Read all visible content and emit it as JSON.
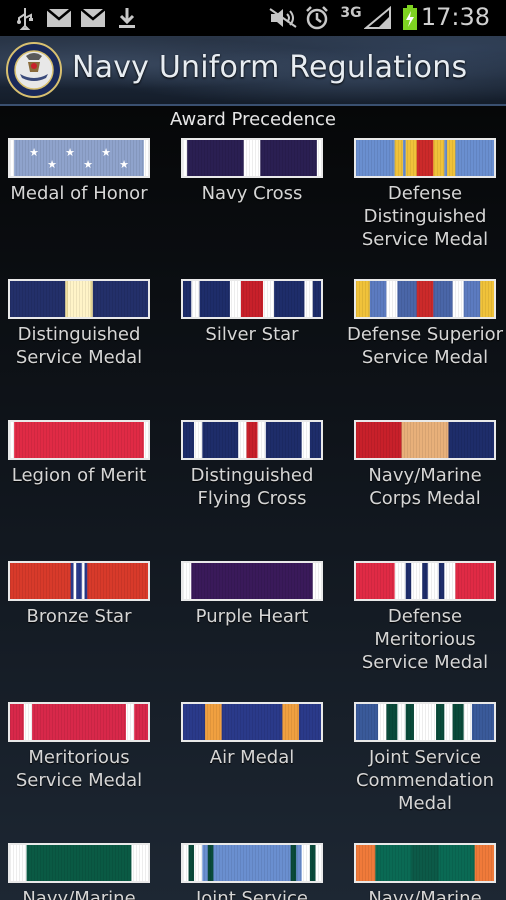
{
  "status_bar": {
    "icons": [
      "usb-icon",
      "gmail-icon",
      "gmail-icon",
      "download-icon",
      "mute-icon",
      "alarm-icon",
      "network-3g-icon",
      "signal-icon",
      "battery-charging-icon"
    ],
    "network_label": "3G",
    "time": "17:38"
  },
  "header": {
    "title": "Navy Uniform Regulations",
    "seal_icon": "navy-seal-icon"
  },
  "section_title": "Award Precedence",
  "awards": [
    {
      "name": "Medal of Honor",
      "slug": "medal-of-honor",
      "stripes": [
        [
          0,
          1,
          "#8fa3cc"
        ],
        [
          0,
          0.03,
          "#ffffff"
        ],
        [
          0.97,
          1,
          "#ffffff"
        ]
      ],
      "stars": true
    },
    {
      "name": "Navy Cross",
      "slug": "navy-cross",
      "stripes": [
        [
          0,
          1,
          "#2a1f52"
        ],
        [
          0.44,
          0.56,
          "#ffffff"
        ],
        [
          0,
          0.03,
          "#ffffff"
        ],
        [
          0.97,
          1,
          "#ffffff"
        ]
      ]
    },
    {
      "name": "Defense Distinguished Service Medal",
      "slug": "defense-distinguished-service-medal",
      "stripes": [
        [
          0,
          1,
          "#6a8fd0"
        ],
        [
          0.28,
          0.72,
          "#f0c23a"
        ],
        [
          0.44,
          0.56,
          "#cc2a2a"
        ],
        [
          0.34,
          0.36,
          "#6a8fd0"
        ],
        [
          0.64,
          0.66,
          "#6a8fd0"
        ]
      ]
    },
    {
      "name": "Distinguished Service Medal",
      "slug": "distinguished-service-medal",
      "stripes": [
        [
          0,
          1,
          "#23306a"
        ],
        [
          0.4,
          0.6,
          "#f0e0a0"
        ],
        [
          0.42,
          0.58,
          "#fff4c8"
        ]
      ]
    },
    {
      "name": "Silver Star",
      "slug": "silver-star",
      "stripes": [
        [
          0,
          1,
          "#1e2d6a"
        ],
        [
          0.06,
          0.12,
          "#ffffff"
        ],
        [
          0.88,
          0.94,
          "#ffffff"
        ],
        [
          0.34,
          0.66,
          "#ffffff"
        ],
        [
          0.42,
          0.58,
          "#c8202a"
        ]
      ]
    },
    {
      "name": "Defense Superior Service Medal",
      "slug": "defense-superior-service-medal",
      "stripes": [
        [
          0,
          1,
          "#f0c23a"
        ],
        [
          0.1,
          0.9,
          "#5c7bc0"
        ],
        [
          0.22,
          0.78,
          "#ffffff"
        ],
        [
          0.3,
          0.7,
          "#4a66a8"
        ],
        [
          0.44,
          0.56,
          "#cc2a2a"
        ]
      ]
    },
    {
      "name": "Legion of Merit",
      "slug": "legion-of-merit",
      "stripes": [
        [
          0,
          1,
          "#e02a45"
        ],
        [
          0,
          0.03,
          "#ffffff"
        ],
        [
          0.97,
          1,
          "#ffffff"
        ]
      ]
    },
    {
      "name": "Distinguished Flying Cross",
      "slug": "distinguished-flying-cross",
      "stripes": [
        [
          0,
          1,
          "#1e2d6a"
        ],
        [
          0.08,
          0.14,
          "#ffffff"
        ],
        [
          0.86,
          0.92,
          "#ffffff"
        ],
        [
          0.4,
          0.6,
          "#ffffff"
        ],
        [
          0.46,
          0.54,
          "#c8202a"
        ]
      ]
    },
    {
      "name": "Navy/Marine Corps Medal",
      "slug": "navy-marine-corps-medal",
      "stripes": [
        [
          0,
          1,
          "#1e2d6a"
        ],
        [
          0,
          0.33,
          "#c8202a"
        ],
        [
          0.33,
          0.67,
          "#e8b07a"
        ]
      ]
    },
    {
      "name": "Bronze Star",
      "slug": "bronze-star",
      "stripes": [
        [
          0,
          1,
          "#d83a2a"
        ],
        [
          0.44,
          0.56,
          "#2a3a8a"
        ],
        [
          0.46,
          0.54,
          "#ffffff"
        ],
        [
          0.48,
          0.52,
          "#2a3a8a"
        ]
      ]
    },
    {
      "name": "Purple Heart",
      "slug": "purple-heart",
      "stripes": [
        [
          0,
          1,
          "#3a1a5a"
        ],
        [
          0,
          0.06,
          "#ffffff"
        ],
        [
          0.94,
          1,
          "#ffffff"
        ]
      ]
    },
    {
      "name": "Defense Meritorious Service Medal",
      "slug": "defense-meritorious-service-medal",
      "stripes": [
        [
          0,
          1,
          "#e02a45"
        ],
        [
          0.28,
          0.72,
          "#ffffff"
        ],
        [
          0.36,
          0.4,
          "#1e2d6a"
        ],
        [
          0.48,
          0.52,
          "#1e2d6a"
        ],
        [
          0.6,
          0.64,
          "#1e2d6a"
        ]
      ]
    },
    {
      "name": "Meritorious Service Medal",
      "slug": "meritorious-service-medal",
      "stripes": [
        [
          0,
          1,
          "#d8284a"
        ],
        [
          0.1,
          0.16,
          "#ffffff"
        ],
        [
          0.84,
          0.9,
          "#ffffff"
        ]
      ]
    },
    {
      "name": "Air Medal",
      "slug": "air-medal",
      "stripes": [
        [
          0,
          1,
          "#2a3a8a"
        ],
        [
          0.16,
          0.28,
          "#f0a040"
        ],
        [
          0.72,
          0.84,
          "#f0a040"
        ]
      ]
    },
    {
      "name": "Joint Service Commendation Medal",
      "slug": "joint-service-commendation-medal",
      "stripes": [
        [
          0,
          1,
          "#3a5a9a"
        ],
        [
          0.16,
          0.84,
          "#ffffff"
        ],
        [
          0.22,
          0.3,
          "#0a4a3a"
        ],
        [
          0.36,
          0.42,
          "#0a4a3a"
        ],
        [
          0.58,
          0.64,
          "#0a4a3a"
        ],
        [
          0.7,
          0.78,
          "#0a4a3a"
        ]
      ]
    },
    {
      "name": "Navy/Marine",
      "slug": "navy-marine-commendation-medal",
      "stripes": [
        [
          0,
          1,
          "#0a5a44"
        ],
        [
          0,
          0.12,
          "#ffffff"
        ],
        [
          0.88,
          1,
          "#ffffff"
        ]
      ]
    },
    {
      "name": "Joint Service",
      "slug": "joint-service-achievement-medal",
      "stripes": [
        [
          0,
          1,
          "#6a8fd0"
        ],
        [
          0,
          0.14,
          "#ffffff"
        ],
        [
          0.86,
          1,
          "#ffffff"
        ],
        [
          0.04,
          0.08,
          "#0a4a3a"
        ],
        [
          0.92,
          0.96,
          "#0a4a3a"
        ],
        [
          0.18,
          0.22,
          "#0a4a3a"
        ],
        [
          0.78,
          0.82,
          "#0a4a3a"
        ]
      ]
    },
    {
      "name": "Navy/Marine",
      "slug": "navy-marine-achievement-medal",
      "stripes": [
        [
          0,
          1,
          "#0a6a54"
        ],
        [
          0,
          0.14,
          "#f07a3a"
        ],
        [
          0.86,
          1,
          "#f07a3a"
        ],
        [
          0.4,
          0.6,
          "#0c5a48"
        ]
      ]
    }
  ]
}
